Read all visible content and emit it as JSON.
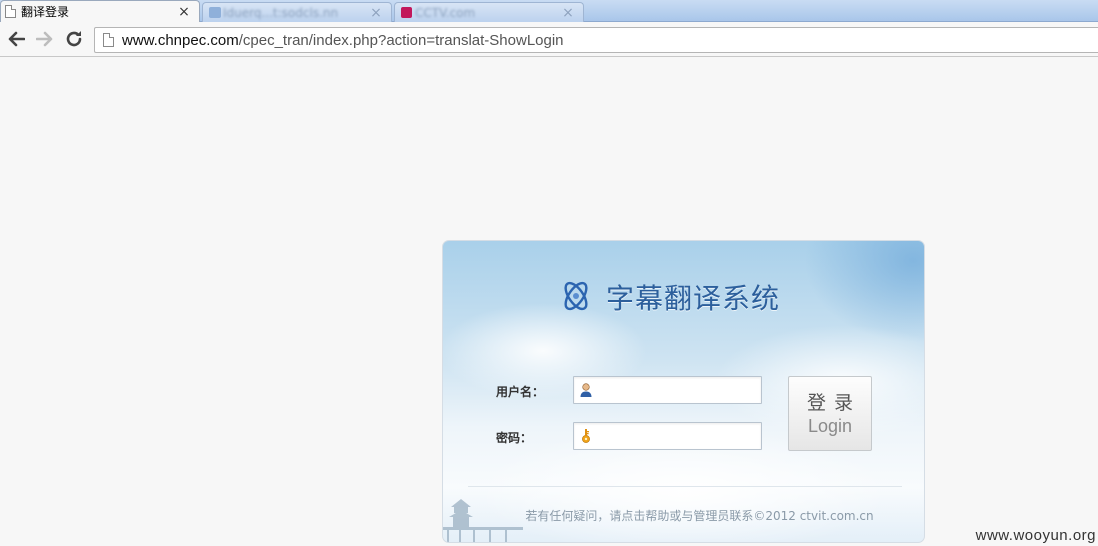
{
  "browser": {
    "tabs": [
      {
        "title": "翻译登录",
        "active": true
      },
      {
        "title": "Iduerq...t:sodcls.nn",
        "active": false
      },
      {
        "title": "CCTV.com",
        "active": false
      }
    ],
    "close_glyph": "×",
    "address": {
      "host": "www.chnpec.com",
      "path": "/cpec_tran/index.php?action=translat-ShowLogin"
    },
    "nav_icons": [
      "back-arrow-icon",
      "forward-arrow-icon",
      "reload-icon",
      "page-icon"
    ]
  },
  "login": {
    "title": "字幕翻译系统",
    "username_label": "用户名：",
    "password_label": "密码：",
    "username_value": "",
    "password_value": "",
    "button_cn": "登录",
    "button_en": "Login",
    "footer": "若有任何疑问，请点击帮助或与管理员联系©2012 ctvit.com.cn",
    "colors": {
      "title": "#2c5f9c",
      "logo": "#2b64b0"
    }
  },
  "watermark": "www.wooyun.org"
}
